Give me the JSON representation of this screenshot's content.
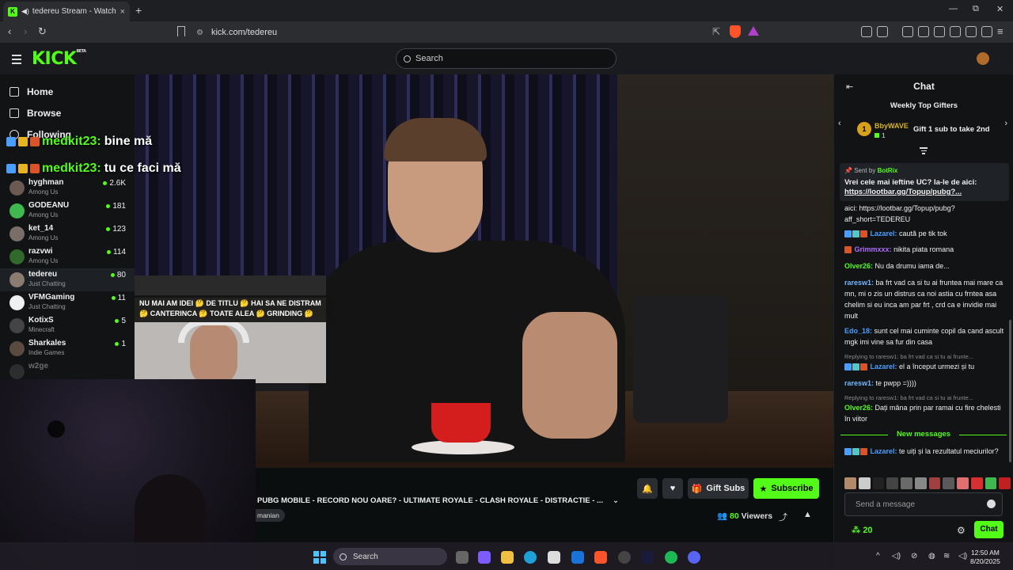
{
  "browser": {
    "tab_title": "tedereu Stream - Watch Live",
    "tab_close": "×",
    "new_tab": "+",
    "url": "kick.com/tedereu",
    "win_min": "—",
    "win_max": "⧉",
    "win_close": "✕"
  },
  "header": {
    "logo": "KICK",
    "logo_sup": "BETA",
    "search_placeholder": "Search"
  },
  "sidebar": {
    "nav": [
      {
        "label": "Home"
      },
      {
        "label": "Browse"
      },
      {
        "label": "Following"
      }
    ],
    "channels": [
      {
        "name": "hyghman",
        "category": "Among Us",
        "viewers": "2.6K"
      },
      {
        "name": "GODEANU",
        "category": "Among Us",
        "viewers": "181"
      },
      {
        "name": "ket_14",
        "category": "Among Us",
        "viewers": "123"
      },
      {
        "name": "razvwi",
        "category": "Among Us",
        "viewers": "114"
      },
      {
        "name": "tedereu",
        "category": "Just Chatting",
        "viewers": "80"
      },
      {
        "name": "VFMGaming",
        "category": "Just Chatting",
        "viewers": "11"
      },
      {
        "name": "KotixS",
        "category": "Minecraft",
        "viewers": "5"
      },
      {
        "name": "Sharkales",
        "category": "Indie Games",
        "viewers": "1"
      },
      {
        "name": "w2ge",
        "category": "",
        "viewers": ""
      }
    ]
  },
  "overlay_chat": [
    {
      "user": "medkit23:",
      "text": "bine mă"
    },
    {
      "user": "medkit23:",
      "text": "tu ce faci mă"
    }
  ],
  "video": {
    "caption": "NU MAI AM IDEI 🤔 DE TITLU 🤔 HAI SA NE DISTRAM 🤔 CANTERINCA 🤔 TOATE ALEA 🤔 GRINDING 🤔"
  },
  "stream": {
    "title": "PUBG MOBILE - RECORD NOU OARE? - ULTIMATE ROYALE - CLASH ROYALE - DISTRACTIE - ...",
    "tag": "manian",
    "viewers_count": "80",
    "viewers_label": "Viewers",
    "gift_subs_label": "Gift Subs",
    "subscribe_label": "Subscribe"
  },
  "chat": {
    "title": "Chat",
    "top_gifters_title": "Weekly Top Gifters",
    "gifter_rank": "1",
    "gifter_name": "BbyWAVE",
    "gifter_count": "1",
    "gift_prompt": "Gift 1 sub to take 2nd",
    "pinned_sent_by": "Sent by",
    "pinned_user": "BotRix",
    "pinned_message": "Vrei cele mai ieftine UC? Ia-le de aici:",
    "pinned_link": "https://lootbar.gg/Topup/pubg?...",
    "messages": [
      {
        "user": "",
        "text": "aici: https://lootbar.gg/Topup/pubg?aff_short=TEDEREU",
        "color": "#f0f0f0"
      },
      {
        "user": "Lazarel:",
        "text": "caută pe tik tok",
        "color": "#4a9eff"
      },
      {
        "user": "Grimmxxx:",
        "text": "nikita piata romana",
        "color": "#b06cff"
      },
      {
        "user": "Olver26:",
        "text": "Nu da drumu iama de...",
        "color": "#53fc18"
      },
      {
        "user": "raresw1:",
        "text": "ba frt vad ca si tu ai fruntea mai mare ca mn, mi o zis un distrus ca noi astia cu frntea asa chelim si eu inca am par frt , crd ca e invidie mai mult",
        "color": "#6fb7ff"
      },
      {
        "user": "Edo_18:",
        "text": "sunt cel mai cuminte copil da cand ascult mgk imi vine sa fur din casa",
        "color": "#4a9eff"
      },
      {
        "user": "Lazarel:",
        "text": "el a început urmezi și tu",
        "color": "#4a9eff"
      },
      {
        "user": "raresw1:",
        "text": "te pwpp =))))",
        "color": "#6fb7ff"
      },
      {
        "user": "Olver26:",
        "text": "Dați mâna prin par ramai cu fire chelesti în viitor",
        "color": "#53fc18"
      },
      {
        "user": "Lazarel:",
        "text": "te uiți și la rezultatul meciurilor?",
        "color": "#4a9eff"
      }
    ],
    "reply_1": "Replying to raresw1: ba frt vad ca si tu ai frunte...",
    "reply_2": "Replying to raresw1: ba frt vad ca si tu ai frunte...",
    "new_messages_label": "New messages",
    "send_placeholder": "Send a message",
    "points": "20",
    "chat_button": "Chat"
  },
  "taskbar": {
    "search_label": "Search",
    "time": "12:50 AM",
    "date": "8/20/2025"
  },
  "colors": {
    "accent": "#53fc18",
    "background": "#0b0e0f"
  }
}
